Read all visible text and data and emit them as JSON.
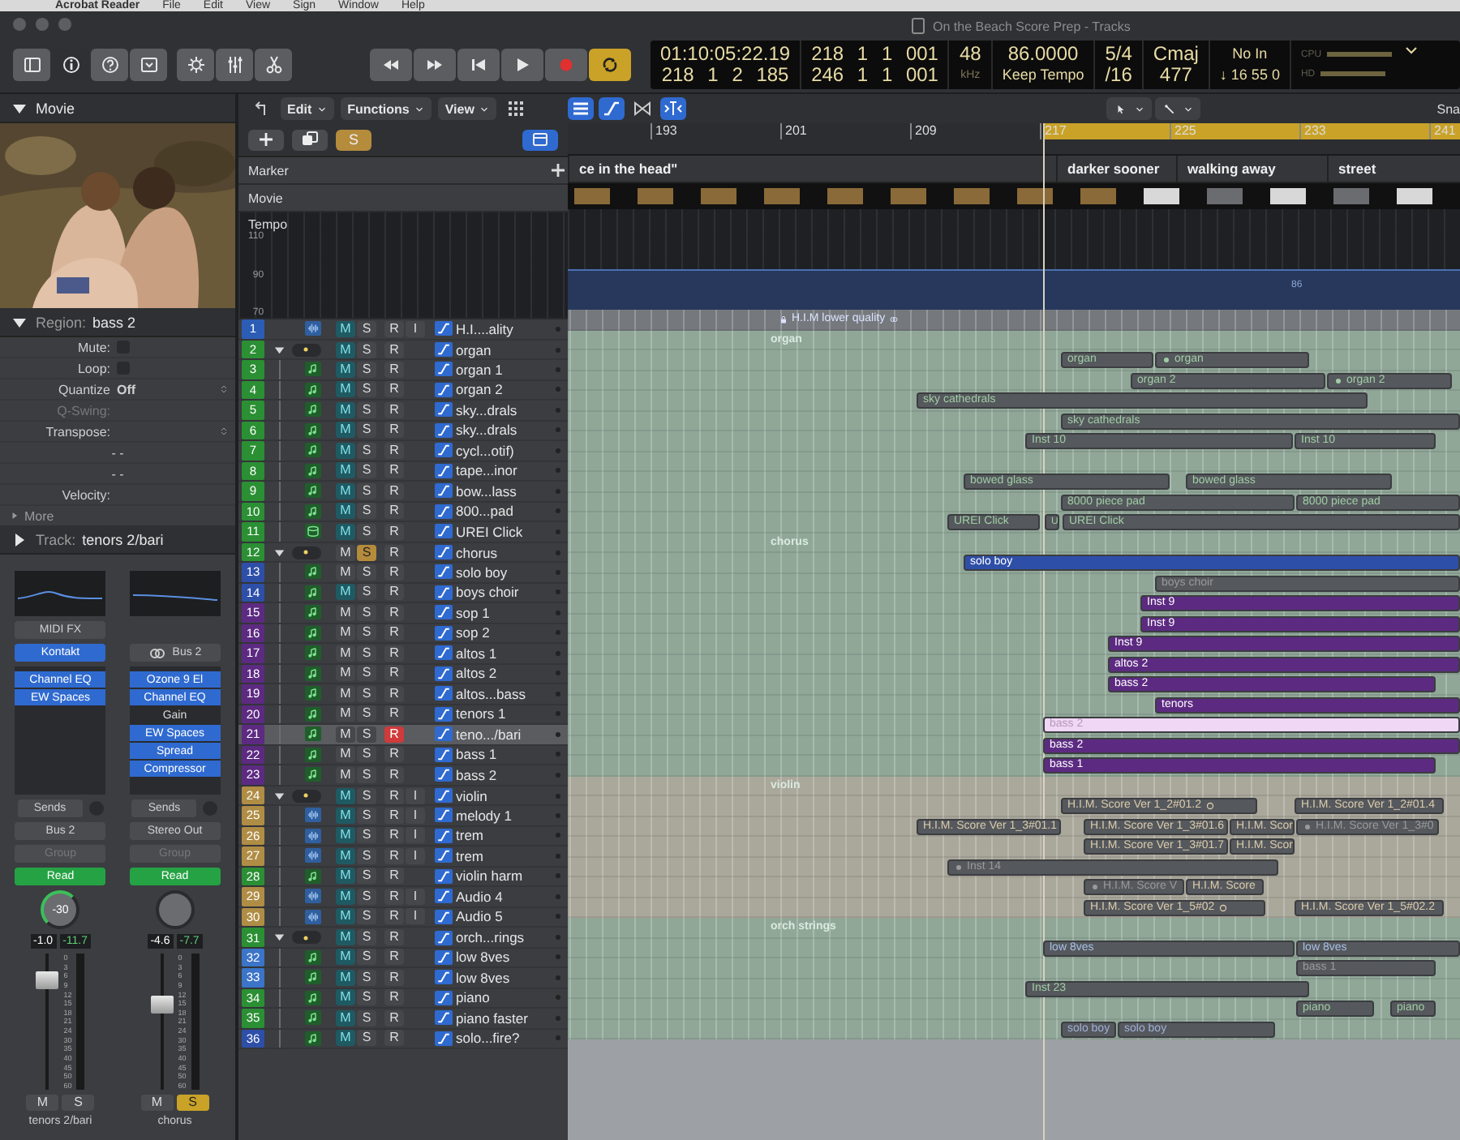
{
  "menubar": {
    "items": [
      "Acrobat Reader",
      "File",
      "Edit",
      "View",
      "Sign",
      "Window",
      "Help"
    ]
  },
  "window": {
    "title": "On the Beach Score Prep - Tracks"
  },
  "toolbar": {
    "view_buttons": [
      {
        "kind": "library",
        "on": false
      },
      {
        "kind": "inspector",
        "on": true
      },
      {
        "kind": "help",
        "on": false
      },
      {
        "kind": "editors",
        "on": false
      }
    ],
    "tool_buttons": [
      {
        "kind": "smart"
      },
      {
        "kind": "mixer"
      },
      {
        "kind": "scissors"
      }
    ],
    "transport": [
      {
        "kind": "rewind",
        "on": false
      },
      {
        "kind": "forward",
        "on": false
      },
      {
        "kind": "tostart",
        "on": false
      },
      {
        "kind": "play",
        "on": false
      },
      {
        "kind": "record",
        "on": false
      },
      {
        "kind": "cycle",
        "on": true
      }
    ]
  },
  "lcd": {
    "timecode": "01:10:05:22.19",
    "end_time": "218 1 2 185",
    "position": "218 1 1 001",
    "end_position": "246 1 1 001",
    "sample_rate": "48",
    "sample_unit": "kHz",
    "tempo": "86.0000",
    "tempo_mode": "Keep Tempo",
    "signature": "5/4",
    "division": "/16",
    "key": "Cmaj",
    "key_value": "477",
    "midi_in": "No In",
    "midi_values": "↓ 16 55 0",
    "meters": [
      "CPU",
      "HD"
    ]
  },
  "inspector": {
    "movie": "Movie",
    "region_label": "Region:",
    "region_name": "bass 2",
    "params": [
      {
        "label": "Mute:",
        "kind": "checkbox",
        "checked": false,
        "disabled": false
      },
      {
        "label": "Loop:",
        "kind": "checkbox",
        "checked": false,
        "disabled": false
      },
      {
        "label": "Quantize",
        "kind": "select",
        "value": "Off",
        "disabled": false
      },
      {
        "label": "Q-Swing:",
        "kind": "text",
        "disabled": true
      },
      {
        "label": "Transpose:",
        "kind": "select",
        "disabled": false
      },
      {
        "label": "- -",
        "kind": "text",
        "disabled": false
      },
      {
        "label": "- -",
        "kind": "text",
        "disabled": false
      },
      {
        "label": "Velocity:",
        "kind": "text",
        "disabled": false
      }
    ],
    "more": "More",
    "track_label": "Track:",
    "track_name": "tenors 2/bari"
  },
  "strips": [
    {
      "midi_fx": "MIDI FX",
      "input": {
        "label": "Kontakt",
        "kind": "instrument"
      },
      "plugins": [
        {
          "name": "Channel EQ",
          "on": true
        },
        {
          "name": "EW Spaces",
          "on": true
        }
      ],
      "sends": "Sends",
      "output": "Bus 2",
      "group": "Group",
      "automation": "Read",
      "pan_label": "-30",
      "volume": "-1.0",
      "peak": "-11.7",
      "scale": [
        "0",
        "3",
        "6",
        "9",
        "12",
        "15",
        "18",
        "21",
        "24",
        "30",
        "35",
        "40",
        "45",
        "50",
        "60"
      ],
      "level": 0.8,
      "mute": "M",
      "solo": "S",
      "mute_on": false,
      "solo_on": false,
      "name": "tenors 2/bari"
    },
    {
      "input": {
        "label": "Bus 2",
        "kind": "bus"
      },
      "plugins": [
        {
          "name": "Ozone 9 El",
          "on": true
        },
        {
          "name": "Channel EQ",
          "on": true
        },
        {
          "name": "Gain",
          "on": false
        },
        {
          "name": "EW Spaces",
          "on": true
        },
        {
          "name": "Spread",
          "on": true
        },
        {
          "name": "Compressor",
          "on": true
        }
      ],
      "sends": "Sends",
      "output": "Stereo Out",
      "group": "Group",
      "automation": "Read",
      "volume": "-4.6",
      "peak": "-7.7",
      "scale": [
        "0",
        "3",
        "6",
        "9",
        "12",
        "15",
        "18",
        "21",
        "24",
        "30",
        "35",
        "40",
        "45",
        "50",
        "60"
      ],
      "level": 0.62,
      "mute": "M",
      "solo": "S",
      "mute_on": false,
      "solo_on": true,
      "name": "chorus"
    }
  ],
  "tracks_toolbar": {
    "menus": [
      "Edit",
      "Functions",
      "View"
    ],
    "solo_button": "S"
  },
  "global_tracks": [
    {
      "name": "Marker"
    },
    {
      "name": "Movie"
    },
    {
      "name": "Tempo",
      "axis": [
        "110",
        "90",
        "70"
      ]
    }
  ],
  "arrange": {
    "snap": "Sna",
    "ruler": [
      "193",
      "201",
      "209",
      "217",
      "225",
      "233",
      "241"
    ],
    "markers": [
      "ce in the head\"",
      "darker sooner",
      "walking away",
      "street"
    ],
    "tempo_value": "86"
  },
  "tracks": [
    {
      "number": "1",
      "name": "H.I....ality",
      "kind": "audio",
      "color": "#2c5db5",
      "mute": "M",
      "solo": "S",
      "record": "R",
      "input": "I",
      "mute_on": true,
      "solo_on": false,
      "record_on": false,
      "selected": false,
      "regions": [
        {
          "kind": "locked",
          "label": "H.I.M lower quality",
          "selected": false,
          "muted": false
        }
      ]
    },
    {
      "number": "2",
      "name": "organ",
      "kind": "folder",
      "expanded": true,
      "color": "#2b8f34",
      "mute": "M",
      "solo": "S",
      "record": "R",
      "mute_on": true,
      "solo_on": false,
      "record_on": false,
      "selected": false,
      "regions": [
        {
          "kind": "folder",
          "label": "organ",
          "selected": false,
          "muted": false
        }
      ],
      "children": [
        {
          "number": "3",
          "name": "organ 1",
          "kind": "midi",
          "color": "#2b8f34",
          "mute": "M",
          "solo": "S",
          "record": "R",
          "mute_on": true,
          "solo_on": false,
          "record_on": false,
          "selected": false,
          "regions": [
            {
              "kind": "plain",
              "label": "organ",
              "selected": false,
              "muted": false
            },
            {
              "kind": "plain",
              "label": "organ",
              "badge": {
                "kind": "dot"
              },
              "selected": false,
              "muted": false
            }
          ]
        },
        {
          "number": "4",
          "name": "organ 2",
          "kind": "midi",
          "color": "#2b8f34",
          "mute": "M",
          "solo": "S",
          "record": "R",
          "mute_on": true,
          "solo_on": false,
          "record_on": false,
          "selected": false,
          "regions": [
            {
              "kind": "plain",
              "label": "organ 2",
              "selected": false,
              "muted": false
            },
            {
              "kind": "plain",
              "label": "organ 2",
              "badge": {
                "kind": "dot"
              },
              "selected": false,
              "muted": false
            }
          ]
        },
        {
          "number": "5",
          "name": "sky...drals",
          "kind": "midi",
          "color": "#2b8f34",
          "mute": "M",
          "solo": "S",
          "record": "R",
          "mute_on": true,
          "solo_on": false,
          "record_on": false,
          "selected": false,
          "regions": [
            {
              "kind": "plain",
              "label": "sky cathedrals",
              "selected": false,
              "muted": false
            }
          ]
        },
        {
          "number": "6",
          "name": "sky...drals",
          "kind": "midi",
          "color": "#2b8f34",
          "mute": "M",
          "solo": "S",
          "record": "R",
          "mute_on": true,
          "solo_on": false,
          "record_on": false,
          "selected": false,
          "regions": [
            {
              "kind": "plain",
              "label": "sky cathedrals",
              "selected": false,
              "muted": false
            }
          ]
        },
        {
          "number": "7",
          "name": "cycl...otif)",
          "kind": "midi",
          "color": "#2b8f34",
          "mute": "M",
          "solo": "S",
          "record": "R",
          "mute_on": true,
          "solo_on": false,
          "record_on": false,
          "selected": false,
          "regions": [
            {
              "kind": "plain",
              "label": "Inst 10",
              "selected": false,
              "muted": false
            },
            {
              "kind": "plain",
              "label": "Inst 10",
              "selected": false,
              "muted": false
            }
          ]
        },
        {
          "number": "8",
          "name": "tape...inor",
          "kind": "midi",
          "color": "#2b8f34",
          "mute": "M",
          "solo": "S",
          "record": "R",
          "mute_on": true,
          "solo_on": false,
          "record_on": false,
          "selected": false
        },
        {
          "number": "9",
          "name": "bow...lass",
          "kind": "midi",
          "color": "#2b8f34",
          "mute": "M",
          "solo": "S",
          "record": "R",
          "mute_on": true,
          "solo_on": false,
          "record_on": false,
          "selected": false,
          "regions": [
            {
              "kind": "plain",
              "label": "bowed glass",
              "selected": false,
              "muted": false
            },
            {
              "kind": "plain",
              "label": "bowed glass",
              "selected": false,
              "muted": false
            }
          ]
        },
        {
          "number": "10",
          "name": "800...pad",
          "kind": "midi",
          "color": "#2b8f34",
          "mute": "M",
          "solo": "S",
          "record": "R",
          "mute_on": true,
          "solo_on": false,
          "record_on": false,
          "selected": false,
          "regions": [
            {
              "kind": "plain",
              "label": "8000 piece pad",
              "selected": false,
              "muted": false
            },
            {
              "kind": "plain",
              "label": "8000 piece pad",
              "selected": false,
              "muted": false
            }
          ]
        },
        {
          "number": "11",
          "name": "UREI Click",
          "kind": "click",
          "color": "#2b8f34",
          "mute": "M",
          "solo": "S",
          "record": "R",
          "mute_on": true,
          "solo_on": false,
          "record_on": false,
          "selected": false,
          "regions": [
            {
              "kind": "plain",
              "label": "UREI Click",
              "selected": false,
              "muted": false
            },
            {
              "kind": "plain",
              "label": "U",
              "selected": false,
              "muted": false
            },
            {
              "kind": "plain",
              "label": "UREI Click",
              "selected": false,
              "muted": false
            }
          ]
        }
      ]
    },
    {
      "number": "12",
      "name": "chorus",
      "kind": "folder",
      "expanded": true,
      "color": "#2b8f34",
      "mute": "M",
      "solo": "S",
      "record": "R",
      "mute_on": false,
      "solo_on": true,
      "record_on": false,
      "selected": false,
      "regions": [
        {
          "kind": "folder",
          "label": "chorus",
          "selected": false,
          "muted": false
        }
      ],
      "children": [
        {
          "number": "13",
          "name": "solo boy",
          "kind": "midi",
          "color": "#2e4fa8",
          "mute": "M",
          "solo": "S",
          "record": "R",
          "mute_on": false,
          "solo_on": false,
          "record_on": false,
          "selected": false,
          "regions": [
            {
              "kind": "filled",
              "label": "solo boy",
              "selected": false,
              "muted": false
            }
          ]
        },
        {
          "number": "14",
          "name": "boys choir",
          "kind": "midi",
          "color": "#2e4fa8",
          "mute": "M",
          "solo": "S",
          "record": "R",
          "mute_on": true,
          "solo_on": false,
          "record_on": false,
          "selected": false,
          "regions": [
            {
              "kind": "plain",
              "label": "boys choir",
              "selected": false,
              "muted": true
            }
          ]
        },
        {
          "number": "15",
          "name": "sop 1",
          "kind": "midi",
          "color": "#5d2a82",
          "mute": "M",
          "solo": "S",
          "record": "R",
          "mute_on": false,
          "solo_on": false,
          "record_on": false,
          "selected": false,
          "regions": [
            {
              "kind": "filled",
              "label": "Inst 9",
              "selected": false,
              "muted": false
            }
          ]
        },
        {
          "number": "16",
          "name": "sop 2",
          "kind": "midi",
          "color": "#5d2a82",
          "mute": "M",
          "solo": "S",
          "record": "R",
          "mute_on": false,
          "solo_on": false,
          "record_on": false,
          "selected": false,
          "regions": [
            {
              "kind": "filled",
              "label": "Inst 9",
              "selected": false,
              "muted": false
            }
          ]
        },
        {
          "number": "17",
          "name": "altos 1",
          "kind": "midi",
          "color": "#5d2a82",
          "mute": "M",
          "solo": "S",
          "record": "R",
          "mute_on": false,
          "solo_on": false,
          "record_on": false,
          "selected": false,
          "regions": [
            {
              "kind": "filled",
              "label": "Inst 9",
              "selected": false,
              "muted": false
            }
          ]
        },
        {
          "number": "18",
          "name": "altos 2",
          "kind": "midi",
          "color": "#5d2a82",
          "mute": "M",
          "solo": "S",
          "record": "R",
          "mute_on": false,
          "solo_on": false,
          "record_on": false,
          "selected": false,
          "regions": [
            {
              "kind": "filled",
              "label": "altos 2",
              "selected": false,
              "muted": false
            }
          ]
        },
        {
          "number": "19",
          "name": "altos...bass",
          "kind": "midi",
          "color": "#5d2a82",
          "mute": "M",
          "solo": "S",
          "record": "R",
          "mute_on": false,
          "solo_on": false,
          "record_on": false,
          "selected": false,
          "regions": [
            {
              "kind": "filled",
              "label": "bass 2",
              "selected": false,
              "muted": false
            }
          ]
        },
        {
          "number": "20",
          "name": "tenors 1",
          "kind": "midi",
          "color": "#5d2a82",
          "mute": "M",
          "solo": "S",
          "record": "R",
          "mute_on": false,
          "solo_on": false,
          "record_on": false,
          "selected": false,
          "regions": [
            {
              "kind": "filled",
              "label": "tenors",
              "selected": false,
              "muted": false
            }
          ]
        },
        {
          "number": "21",
          "name": "teno.../bari",
          "kind": "midi",
          "color": "#5d2a82",
          "mute": "M",
          "solo": "S",
          "record": "R",
          "mute_on": false,
          "solo_on": false,
          "record_on": true,
          "selected": true,
          "regions": [
            {
              "kind": "filled",
              "label": "bass 2",
              "selected": true,
              "muted": false
            }
          ]
        },
        {
          "number": "22",
          "name": "bass 1",
          "kind": "midi",
          "color": "#5d2a82",
          "mute": "M",
          "solo": "S",
          "record": "R",
          "mute_on": false,
          "solo_on": false,
          "record_on": false,
          "selected": false,
          "regions": [
            {
              "kind": "filled",
              "label": "bass 2",
              "selected": false,
              "muted": false
            }
          ]
        },
        {
          "number": "23",
          "name": "bass 2",
          "kind": "midi",
          "color": "#5d2a82",
          "mute": "M",
          "solo": "S",
          "record": "R",
          "mute_on": false,
          "solo_on": false,
          "record_on": false,
          "selected": false,
          "regions": [
            {
              "kind": "filled",
              "label": "bass 1",
              "selected": false,
              "muted": false
            }
          ]
        }
      ]
    },
    {
      "number": "24",
      "name": "violin",
      "kind": "folder",
      "expanded": true,
      "color": "#b08d45",
      "mute": "M",
      "solo": "S",
      "record": "R",
      "input": "I",
      "mute_on": true,
      "solo_on": false,
      "record_on": false,
      "selected": false,
      "regions": [
        {
          "kind": "folder",
          "label": "violin",
          "selected": false,
          "muted": false
        }
      ],
      "children": [
        {
          "number": "25",
          "name": "melody 1",
          "kind": "audio",
          "color": "#b08d45",
          "mute": "M",
          "solo": "S",
          "record": "R",
          "input": "I",
          "mute_on": true,
          "solo_on": false,
          "record_on": false,
          "selected": false,
          "regions": [
            {
              "kind": "plain",
              "label": "H.I.M. Score Ver 1_2#01.2",
              "badge": {
                "kind": "ring"
              },
              "selected": false,
              "muted": false
            },
            {
              "kind": "plain",
              "label": "H.I.M. Score Ver 1_2#01.4",
              "selected": false,
              "muted": false
            }
          ]
        },
        {
          "number": "26",
          "name": "trem",
          "kind": "audio",
          "color": "#b08d45",
          "mute": "M",
          "solo": "S",
          "record": "R",
          "input": "I",
          "mute_on": true,
          "solo_on": false,
          "record_on": false,
          "selected": false,
          "regions": [
            {
              "kind": "plain",
              "label": "H.I.M. Score Ver 1_3#01.1",
              "selected": false,
              "muted": false
            },
            {
              "kind": "plain",
              "label": "H.I.M. Score Ver 1_3#01.6",
              "selected": false,
              "muted": false
            },
            {
              "kind": "plain",
              "label": "H.I.M. Scor",
              "selected": false,
              "muted": false
            },
            {
              "kind": "plain",
              "label": "H.I.M. Score Ver 1_3#0",
              "badge": {
                "kind": "dot"
              },
              "selected": false,
              "muted": true
            }
          ]
        },
        {
          "number": "27",
          "name": "trem",
          "kind": "audio",
          "color": "#b08d45",
          "mute": "M",
          "solo": "S",
          "record": "R",
          "input": "I",
          "mute_on": true,
          "solo_on": false,
          "record_on": false,
          "selected": false,
          "regions": [
            {
              "kind": "plain",
              "label": "H.I.M. Score Ver 1_3#01.7",
              "selected": false,
              "muted": false
            },
            {
              "kind": "plain",
              "label": "H.I.M. Scor",
              "selected": false,
              "muted": false
            }
          ]
        },
        {
          "number": "28",
          "name": "violin harm",
          "kind": "midi",
          "color": "#2b8f34",
          "mute": "M",
          "solo": "S",
          "record": "R",
          "mute_on": true,
          "solo_on": false,
          "record_on": false,
          "selected": false,
          "regions": [
            {
              "kind": "plain",
              "label": "Inst 14",
              "badge": {
                "kind": "dot"
              },
              "selected": false,
              "muted": true
            }
          ]
        },
        {
          "number": "29",
          "name": "Audio 4",
          "kind": "audio",
          "color": "#b08d45",
          "mute": "M",
          "solo": "S",
          "record": "R",
          "input": "I",
          "mute_on": true,
          "solo_on": false,
          "record_on": false,
          "selected": false,
          "regions": [
            {
              "kind": "plain",
              "label": "H.I.M. Score V",
              "badge": {
                "kind": "dot"
              },
              "selected": false,
              "muted": true
            },
            {
              "kind": "plain",
              "label": "H.I.M. Score",
              "selected": false,
              "muted": false
            }
          ]
        },
        {
          "number": "30",
          "name": "Audio 5",
          "kind": "audio",
          "color": "#b08d45",
          "mute": "M",
          "solo": "S",
          "record": "R",
          "input": "I",
          "mute_on": true,
          "solo_on": false,
          "record_on": false,
          "selected": false,
          "regions": [
            {
              "kind": "plain",
              "label": "H.I.M. Score Ver 1_5#02",
              "badge": {
                "kind": "ring"
              },
              "selected": false,
              "muted": false
            },
            {
              "kind": "plain",
              "label": "H.I.M. Score Ver 1_5#02.2",
              "selected": false,
              "muted": false
            }
          ]
        }
      ]
    },
    {
      "number": "31",
      "name": "orch...rings",
      "kind": "folder",
      "expanded": true,
      "color": "#2b8f34",
      "mute": "M",
      "solo": "S",
      "record": "R",
      "mute_on": true,
      "solo_on": false,
      "record_on": false,
      "selected": false,
      "regions": [
        {
          "kind": "folder",
          "label": "orch strings",
          "selected": false,
          "muted": false
        }
      ],
      "children": [
        {
          "number": "32",
          "name": "low 8ves",
          "kind": "midi",
          "color": "#3b74c8",
          "mute": "M",
          "solo": "S",
          "record": "R",
          "mute_on": true,
          "solo_on": false,
          "record_on": false,
          "selected": false,
          "regions": [
            {
              "kind": "plain",
              "label": "low 8ves",
              "selected": false,
              "muted": false
            },
            {
              "kind": "plain",
              "label": "low 8ves",
              "selected": false,
              "muted": false
            }
          ]
        },
        {
          "number": "33",
          "name": "low 8ves",
          "kind": "midi",
          "color": "#3b74c8",
          "mute": "M",
          "solo": "S",
          "record": "R",
          "mute_on": true,
          "solo_on": false,
          "record_on": false,
          "selected": false,
          "regions": [
            {
              "kind": "plain",
              "label": "bass 1",
              "selected": false,
              "muted": true
            }
          ]
        },
        {
          "number": "34",
          "name": "piano",
          "kind": "midi",
          "color": "#2b8f34",
          "mute": "M",
          "solo": "S",
          "record": "R",
          "mute_on": true,
          "solo_on": false,
          "record_on": false,
          "selected": false,
          "regions": [
            {
              "kind": "plain",
              "label": "Inst 23",
              "selected": false,
              "muted": false
            }
          ]
        },
        {
          "number": "35",
          "name": "piano faster",
          "kind": "midi",
          "color": "#2b8f34",
          "mute": "M",
          "solo": "S",
          "record": "R",
          "mute_on": true,
          "solo_on": false,
          "record_on": false,
          "selected": false,
          "regions": [
            {
              "kind": "plain",
              "label": "piano",
              "selected": false,
              "muted": false
            },
            {
              "kind": "plain",
              "label": "piano",
              "selected": false,
              "muted": false
            }
          ]
        },
        {
          "number": "36",
          "name": "solo...fire?",
          "kind": "midi",
          "color": "#2e4fa8",
          "mute": "M",
          "solo": "S",
          "record": "R",
          "mute_on": true,
          "solo_on": false,
          "record_on": false,
          "selected": false,
          "regions": [
            {
              "kind": "plain",
              "label": "solo boy",
              "selected": false,
              "muted": false
            },
            {
              "kind": "plain",
              "label": "solo boy",
              "selected": false,
              "muted": false
            }
          ]
        }
      ]
    }
  ]
}
